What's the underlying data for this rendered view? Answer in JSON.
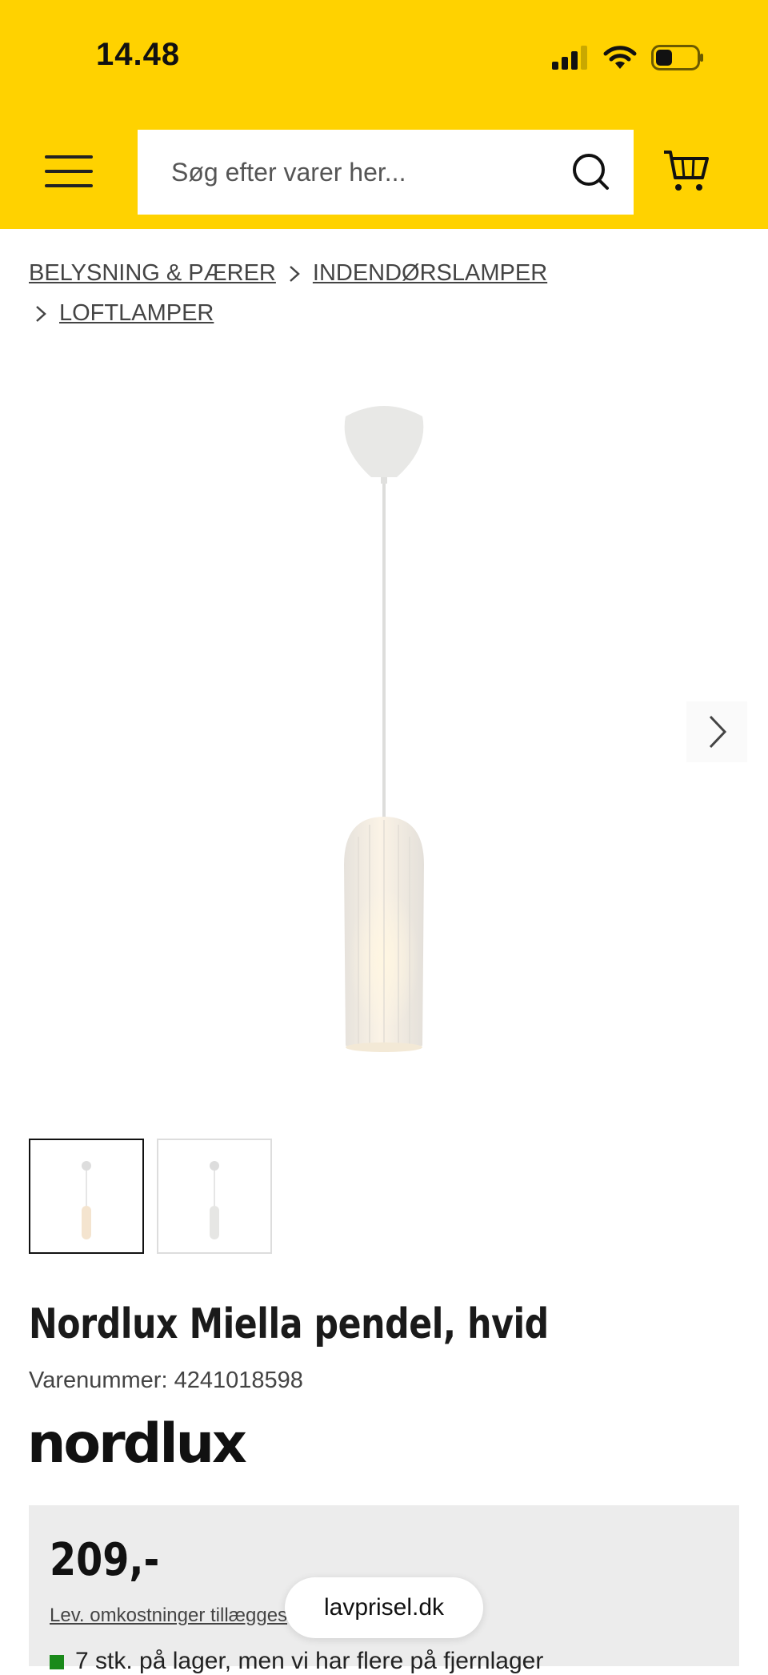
{
  "status_bar": {
    "time": "14.48"
  },
  "header": {
    "brand_color": "#FFD200",
    "search": {
      "placeholder": "Søg efter varer her..."
    }
  },
  "breadcrumb": [
    {
      "label": "BELYSNING & PÆRER"
    },
    {
      "label": "INDENDØRSLAMPER"
    },
    {
      "label": "LOFTLAMPER"
    }
  ],
  "product": {
    "title": "Nordlux Miella pendel, hvid",
    "sku": "Varenummer: 4241018598",
    "brand_logo": "nordlux",
    "price": "209,-",
    "shipping_link": "Lev. omkostninger tillægges",
    "stock": "7 stk. på lager, men vi har flere på fjernlager",
    "stock_color": "#1a8a1a"
  },
  "browser": {
    "url": "lavprisel.dk"
  }
}
